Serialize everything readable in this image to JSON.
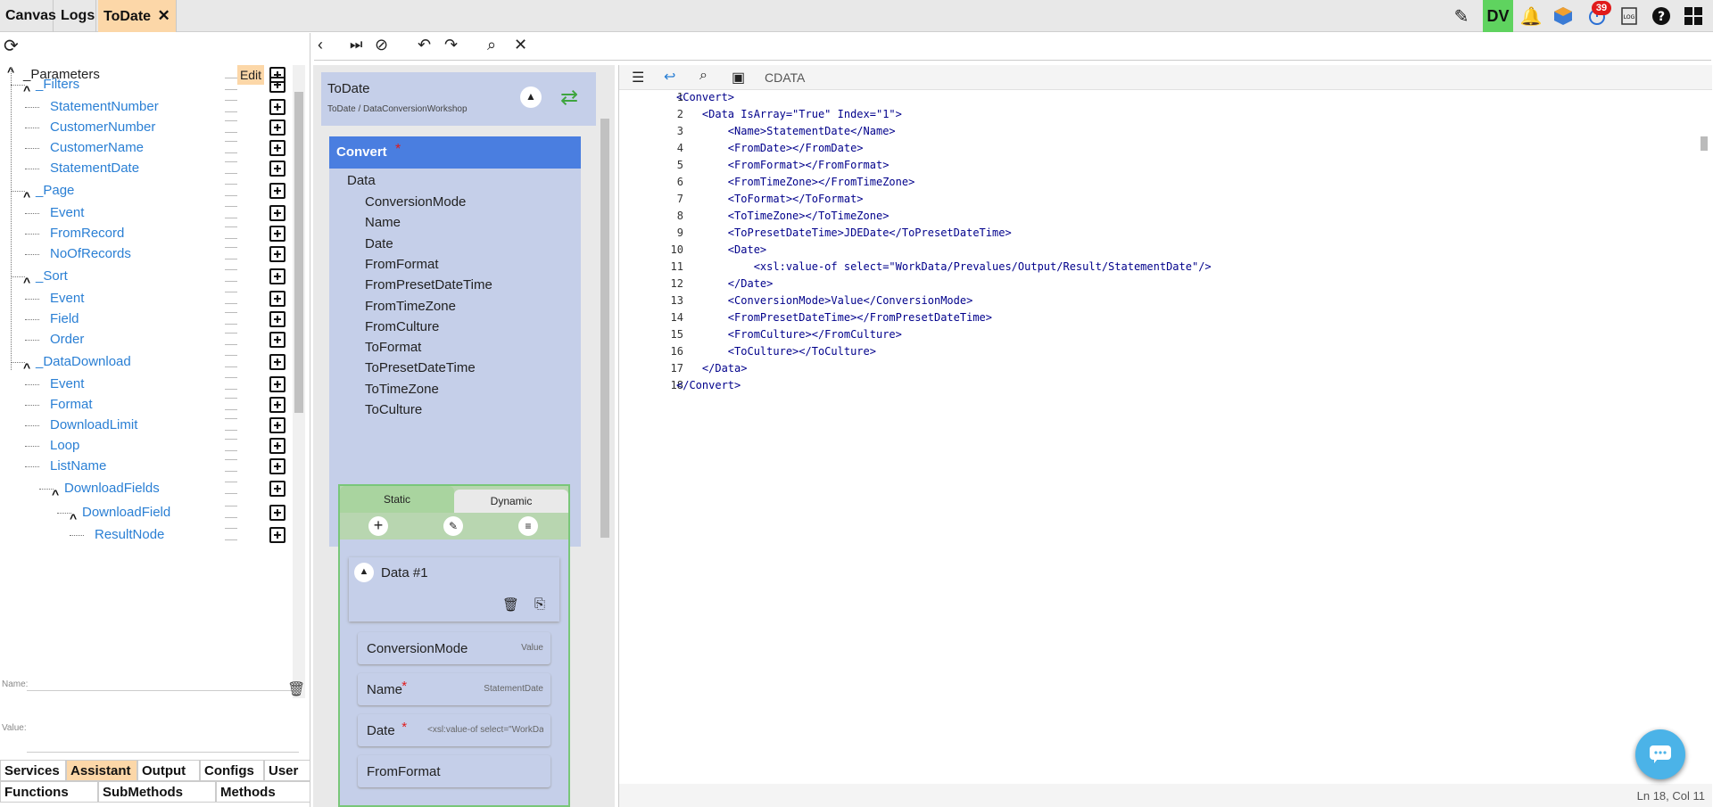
{
  "tabs": [
    {
      "label": "Canvas"
    },
    {
      "label": "Logs"
    },
    {
      "label": "ToDate"
    }
  ],
  "top_badge": "39",
  "user_initials": "DV",
  "left_panel": {
    "params_label": "_Parameters",
    "edit_label": "Edit",
    "tree": [
      {
        "label": "_Filters",
        "level": 1,
        "group": true
      },
      {
        "label": "StatementNumber",
        "level": 2
      },
      {
        "label": "CustomerNumber",
        "level": 2
      },
      {
        "label": "CustomerName",
        "level": 2
      },
      {
        "label": "StatementDate",
        "level": 2
      },
      {
        "label": "_Page",
        "level": 1,
        "group": true
      },
      {
        "label": "Event",
        "level": 2
      },
      {
        "label": "FromRecord",
        "level": 2
      },
      {
        "label": "NoOfRecords",
        "level": 2
      },
      {
        "label": "_Sort",
        "level": 1,
        "group": true
      },
      {
        "label": "Event",
        "level": 2
      },
      {
        "label": "Field",
        "level": 2
      },
      {
        "label": "Order",
        "level": 2
      },
      {
        "label": "_DataDownload",
        "level": 1,
        "group": true
      },
      {
        "label": "Event",
        "level": 2
      },
      {
        "label": "Format",
        "level": 2
      },
      {
        "label": "DownloadLimit",
        "level": 2
      },
      {
        "label": "Loop",
        "level": 2
      },
      {
        "label": "ListName",
        "level": 2
      },
      {
        "label": "DownloadFields",
        "level": 3,
        "group": true
      },
      {
        "label": "DownloadField",
        "level": 4,
        "group": true
      },
      {
        "label": "ResultNode",
        "level": 5
      }
    ],
    "name_placeholder": "Name:",
    "value_placeholder": "Value:",
    "bottom_tabs_row1": [
      {
        "label": "Services"
      },
      {
        "label": "Assistant"
      },
      {
        "label": "Output"
      },
      {
        "label": "Configs"
      },
      {
        "label": "User"
      }
    ],
    "bottom_tabs_row2": [
      {
        "label": "Functions"
      },
      {
        "label": "SubMethods"
      },
      {
        "label": "Methods"
      }
    ]
  },
  "middle_panel": {
    "title": "ToDate",
    "subtitle": "ToDate / DataConversionWorkshop",
    "convert_label": "Convert",
    "data_label": "Data",
    "fields": [
      {
        "label": "ConversionMode"
      },
      {
        "label": "Name"
      },
      {
        "label": "Date"
      },
      {
        "label": "FromFormat"
      },
      {
        "label": "FromPresetDateTime"
      },
      {
        "label": "FromTimeZone"
      },
      {
        "label": "FromCulture"
      },
      {
        "label": "ToFormat"
      },
      {
        "label": "ToPresetDateTime"
      },
      {
        "label": "ToTimeZone"
      },
      {
        "label": "ToCulture"
      }
    ],
    "static_tab": "Static",
    "dynamic_tab": "Dynamic",
    "data_item_label": "Data #1",
    "cards": [
      {
        "label": "ConversionMode",
        "value": "Value",
        "required": false
      },
      {
        "label": "Name",
        "value": "StatementDate",
        "required": true
      },
      {
        "label": "Date",
        "value": "<xsl:value-of select=\"WorkDa...",
        "required": true
      },
      {
        "label": "FromFormat",
        "value": "",
        "required": false
      }
    ]
  },
  "editor": {
    "mode_label": "CDATA",
    "status": "Ln 18, Col 11",
    "lines": [
      "<Convert>",
      "    <Data IsArray=\"True\" Index=\"1\">",
      "        <Name>StatementDate</Name>",
      "        <FromDate></FromDate>",
      "        <FromFormat></FromFormat>",
      "        <FromTimeZone></FromTimeZone>",
      "        <ToFormat></ToFormat>",
      "        <ToTimeZone></ToTimeZone>",
      "        <ToPresetDateTime>JDEDate</ToPresetDateTime>",
      "        <Date>",
      "            <xsl:value-of select=\"WorkData/Prevalues/Output/Result/StatementDate\"/>",
      "        </Date>",
      "        <ConversionMode>Value</ConversionMode>",
      "        <FromPresetDateTime></FromPresetDateTime>",
      "        <FromCulture></FromCulture>",
      "        <ToCulture></ToCulture>",
      "    </Data>",
      "</Convert>"
    ]
  },
  "colors": {
    "accent": "#fcd7a8",
    "selected": "#4a7ee0",
    "panel": "#c5cfe9",
    "green": "#3ea53e"
  }
}
